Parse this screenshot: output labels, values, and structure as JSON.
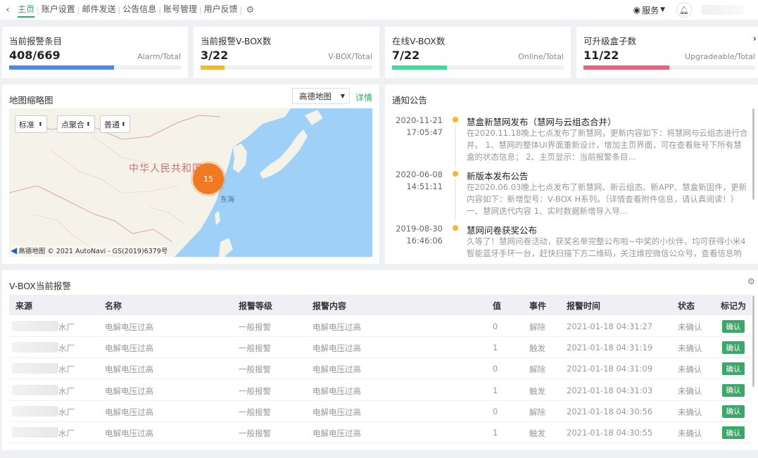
{
  "nav": {
    "back_icon": "chevron-left-icon",
    "items": [
      {
        "label": "主页",
        "active": true
      },
      {
        "label": "账户设置",
        "active": false
      },
      {
        "label": "邮件发送",
        "active": false
      },
      {
        "label": "公告信息",
        "active": false
      },
      {
        "label": "账号管理",
        "active": false
      },
      {
        "label": "用户反馈",
        "active": false
      }
    ],
    "separator": "|",
    "settings_icon": "gear-icon",
    "service_label": "服务",
    "bell_icon": "bell-icon"
  },
  "stats": [
    {
      "title": "当前报警条目",
      "value": "408/669",
      "unit": "Alarm/Total",
      "progress": 0.61,
      "color": "#4f86ec"
    },
    {
      "title": "当前报警V-BOX数",
      "value": "3/22",
      "unit": "V-BOX/Total",
      "progress": 0.14,
      "color": "#f5b72b"
    },
    {
      "title": "在线V-BOX数",
      "value": "7/22",
      "unit": "Online/Total",
      "progress": 0.32,
      "color": "#3ddc97"
    },
    {
      "title": "可升级盒子数",
      "value": "11/22",
      "unit": "Upgradeable/Total",
      "progress": 0.5,
      "color": "#f0607a"
    }
  ],
  "map": {
    "title": "地图缩略图",
    "provider_select": "高德地图",
    "detail_link": "详情",
    "controls": [
      "标准",
      "点聚合",
      "普通"
    ],
    "country_label": "中华人民共和国",
    "sea_label": "东海",
    "cluster_count": "15",
    "attribution_logo": "高德地图",
    "attribution": "© 2021 AutoNavi - GS(2019)6379号"
  },
  "notices": {
    "title": "通知公告",
    "items": [
      {
        "date": "2020-11-21",
        "time": "17:05:47",
        "title": "慧盒新慧网发布（慧网与云组态合并）",
        "body": "在2020.11.18晚上七点发布了新慧网，更新内容如下：将慧网与云组态进行合并。 1、慧网的整体UI界面重新设计，增加主页界面，可在查看账号下所有慧盒的状态信息； 2、主页显示：当前报警条目..."
      },
      {
        "date": "2020-06-08",
        "time": "14:51:11",
        "title": "新版本发布公告",
        "body": "在2020.06.03晚上七点发布了新慧网、新云组态、新APP、慧盒新固件，更新内容如下：新增型号：V-BOX H系列。（详情查看附件信息，请认真阅读！） 一、慧网迭代内容 1、实时数据新增导入导..."
      },
      {
        "date": "2019-08-30",
        "time": "16:46:06",
        "title": "慧网问卷获奖公布",
        "body": "久等了！慧网问卷活动，获奖名单完整公布啦~中奖的小伙伴，均可获得小米4智能蓝牙手环一台，赶快扫描下方二维码，关注维控微信公众号，查看信息哟"
      }
    ]
  },
  "alarms": {
    "title": "V-BOX当前报警",
    "columns": [
      "来源",
      "名称",
      "报警等级",
      "报警内容",
      "值",
      "事件",
      "报警时间",
      "状态",
      "标记为"
    ],
    "rows": [
      {
        "source": "水厂",
        "name": "电解电压过高",
        "level": "一般报警",
        "content": "电解电压过高",
        "value": "0",
        "event": "解除",
        "time": "2021-01-18 04:31:27",
        "status": "未确认",
        "action": "确认"
      },
      {
        "source": "水厂",
        "name": "电解电压过高",
        "level": "一般报警",
        "content": "电解电压过高",
        "value": "1",
        "event": "触发",
        "time": "2021-01-18 04:31:19",
        "status": "未确认",
        "action": "确认"
      },
      {
        "source": "水厂",
        "name": "电解电压过高",
        "level": "一般报警",
        "content": "电解电压过高",
        "value": "0",
        "event": "解除",
        "time": "2021-01-18 04:31:09",
        "status": "未确认",
        "action": "确认"
      },
      {
        "source": "水厂",
        "name": "电解电压过高",
        "level": "一般报警",
        "content": "电解电压过高",
        "value": "1",
        "event": "触发",
        "time": "2021-01-18 04:31:03",
        "status": "未确认",
        "action": "确认"
      },
      {
        "source": "水厂",
        "name": "电解电压过高",
        "level": "一般报警",
        "content": "电解电压过高",
        "value": "0",
        "event": "解除",
        "time": "2021-01-18 04:30:56",
        "status": "未确认",
        "action": "确认"
      },
      {
        "source": "水厂",
        "name": "电解电压过高",
        "level": "一般报警",
        "content": "电解电压过高",
        "value": "1",
        "event": "触发",
        "time": "2021-01-18 04:30:55",
        "status": "未确认",
        "action": "确认"
      }
    ]
  }
}
